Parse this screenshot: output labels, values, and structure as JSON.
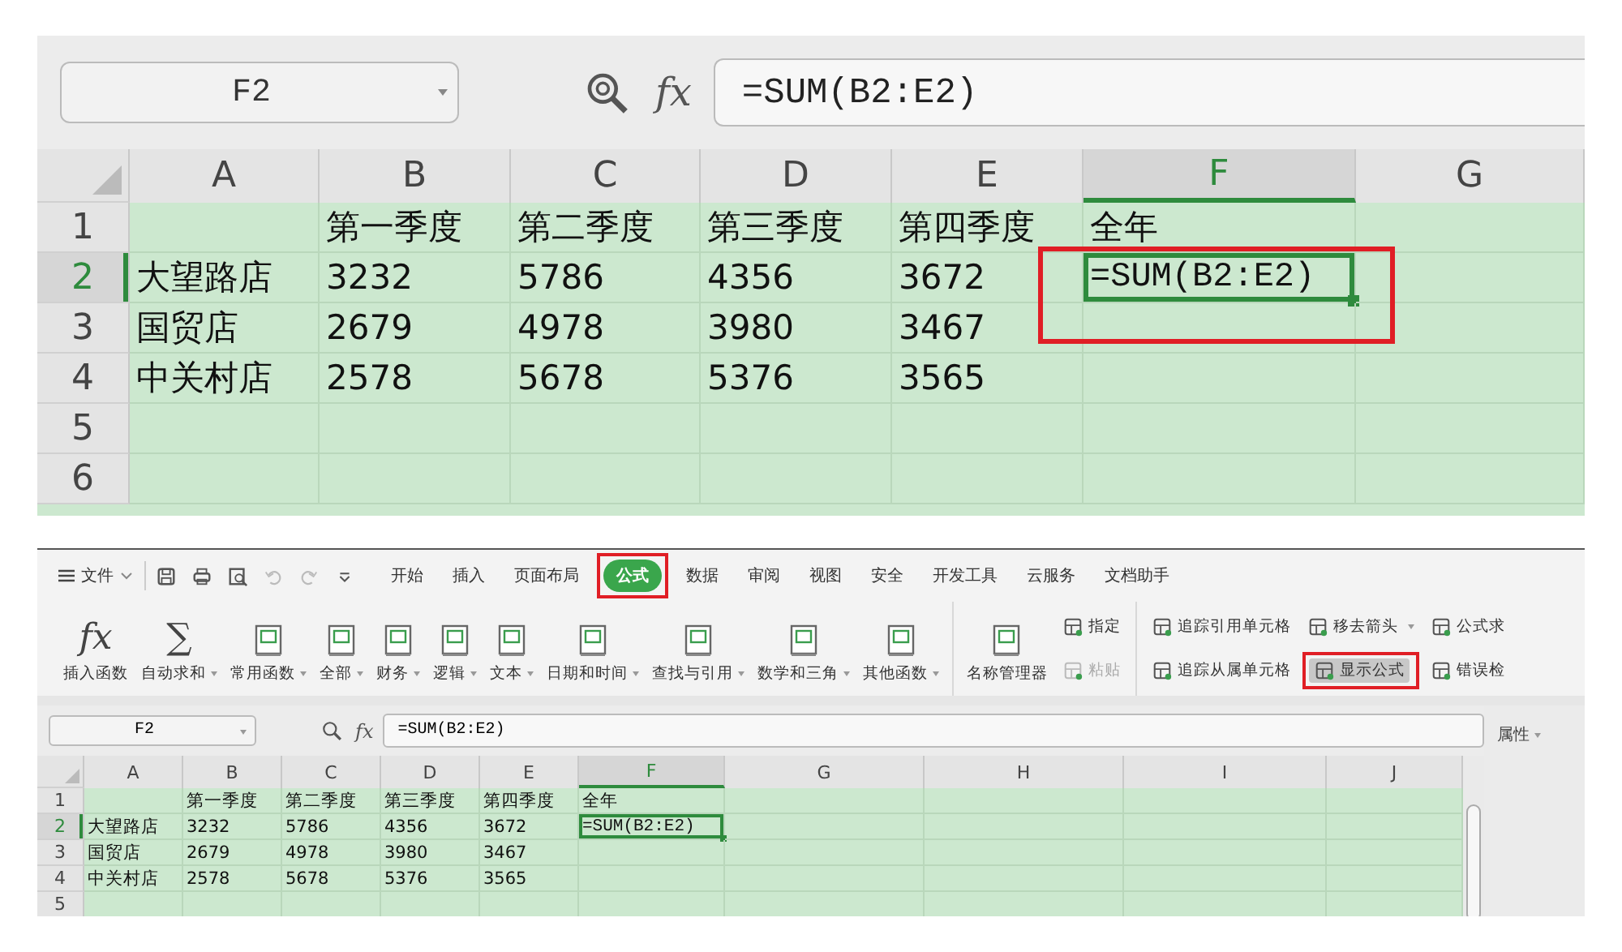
{
  "top_view": {
    "name_box": "F2",
    "fx": "fx",
    "formula": "=SUM(B2:E2)",
    "columns": [
      {
        "label": "A",
        "selected": false
      },
      {
        "label": "B",
        "selected": false
      },
      {
        "label": "C",
        "selected": false
      },
      {
        "label": "D",
        "selected": false
      },
      {
        "label": "E",
        "selected": false
      },
      {
        "label": "F",
        "selected": true
      },
      {
        "label": "G",
        "selected": false
      }
    ],
    "rows": [
      {
        "number": "1",
        "selected": false,
        "cells": [
          {
            "selected": false
          },
          {
            "text": "第一季度",
            "selected": false
          },
          {
            "text": "第二季度",
            "selected": false
          },
          {
            "text": "第三季度",
            "selected": false
          },
          {
            "text": "第四季度",
            "selected": false
          },
          {
            "text": "全年",
            "selected": false
          },
          {
            "selected": false
          }
        ]
      },
      {
        "number": "2",
        "selected": true,
        "cells": [
          {
            "text": "大望路店",
            "selected": false
          },
          {
            "text": "3232",
            "selected": false
          },
          {
            "text": "5786",
            "selected": false
          },
          {
            "text": "4356",
            "selected": false
          },
          {
            "text": "3672",
            "selected": false
          },
          {
            "text": "=SUM(B2:E2)",
            "selected": true,
            "callout": true
          },
          {
            "selected": false
          }
        ]
      },
      {
        "number": "3",
        "selected": false,
        "cells": [
          {
            "text": "国贸店",
            "selected": false
          },
          {
            "text": "2679",
            "selected": false
          },
          {
            "text": "4978",
            "selected": false
          },
          {
            "text": "3980",
            "selected": false
          },
          {
            "text": "3467",
            "selected": false
          },
          {
            "selected": false
          },
          {
            "selected": false
          }
        ]
      },
      {
        "number": "4",
        "selected": false,
        "cells": [
          {
            "text": "中关村店",
            "selected": false
          },
          {
            "text": "2578",
            "selected": false
          },
          {
            "text": "5678",
            "selected": false
          },
          {
            "text": "5376",
            "selected": false
          },
          {
            "text": "3565",
            "selected": false
          },
          {
            "selected": false
          },
          {
            "selected": false
          }
        ]
      },
      {
        "number": "5",
        "selected": false,
        "cells": [
          {
            "selected": false
          },
          {
            "selected": false
          },
          {
            "selected": false
          },
          {
            "selected": false
          },
          {
            "selected": false
          },
          {
            "selected": false
          },
          {
            "selected": false
          }
        ]
      },
      {
        "number": "6",
        "selected": false,
        "cells": [
          {
            "selected": false
          },
          {
            "selected": false
          },
          {
            "selected": false
          },
          {
            "selected": false
          },
          {
            "selected": false
          },
          {
            "selected": false
          },
          {
            "selected": false
          }
        ]
      }
    ]
  },
  "bottom_view": {
    "menu": {
      "label": "文件"
    },
    "quick_access": [
      {
        "disabled": false
      },
      {
        "disabled": false
      },
      {
        "disabled": false
      },
      {
        "disabled": true
      },
      {
        "disabled": true
      },
      {
        "disabled": false
      }
    ],
    "tabs": [
      {
        "label": "开始",
        "selected": false
      },
      {
        "label": "插入",
        "selected": false
      },
      {
        "label": "页面布局",
        "selected": false
      },
      {
        "label": "公式",
        "selected": true,
        "callout": true
      },
      {
        "label": "数据",
        "selected": false
      },
      {
        "label": "审阅",
        "selected": false
      },
      {
        "label": "视图",
        "selected": false
      },
      {
        "label": "安全",
        "selected": false
      },
      {
        "label": "开发工具",
        "selected": false
      },
      {
        "label": "云服务",
        "selected": false
      },
      {
        "label": "文档助手",
        "selected": false
      }
    ],
    "ribbon": [
      {
        "items": [
          {
            "kind": "glyph",
            "glyph": "fx",
            "label": "插入函数",
            "dropdown": false
          },
          {
            "kind": "glyph",
            "glyph": "∑",
            "label": "自动求和",
            "dropdown": true
          },
          {
            "kind": "large",
            "label": "常用函数",
            "dropdown": true
          },
          {
            "kind": "large",
            "label": "全部",
            "dropdown": true
          },
          {
            "kind": "large",
            "label": "财务",
            "dropdown": true
          },
          {
            "kind": "large",
            "label": "逻辑",
            "dropdown": true
          },
          {
            "kind": "large",
            "label": "文本",
            "dropdown": true
          },
          {
            "kind": "large",
            "label": "日期和时间",
            "dropdown": true
          },
          {
            "kind": "large",
            "label": "查找与引用",
            "dropdown": true
          },
          {
            "kind": "large",
            "label": "数学和三角",
            "dropdown": true
          },
          {
            "kind": "large",
            "label": "其他函数",
            "dropdown": true
          }
        ]
      },
      {
        "items": [
          {
            "kind": "large",
            "label": "名称管理器",
            "dropdown": false
          },
          {
            "kind": "small",
            "label": "指定",
            "dropdown": false,
            "disabled": false
          },
          {
            "kind": "small",
            "label": "粘贴",
            "dropdown": false,
            "disabled": true
          }
        ]
      },
      {
        "items": [
          {
            "kind": "small",
            "label": "追踪引用单元格",
            "dropdown": false,
            "disabled": false
          },
          {
            "kind": "small",
            "label": "追踪从属单元格",
            "dropdown": false,
            "disabled": false
          },
          {
            "kind": "small",
            "label": "移去箭头",
            "dropdown": true,
            "disabled": false
          },
          {
            "kind": "small",
            "label": "显示公式",
            "dropdown": false,
            "disabled": false,
            "pressed": true,
            "callout": true
          },
          {
            "kind": "small",
            "label": "公式求",
            "dropdown": false,
            "disabled": false
          },
          {
            "kind": "small",
            "label": "错误检",
            "dropdown": false,
            "disabled": false
          }
        ]
      }
    ],
    "name_box": "F2",
    "fx": "fx",
    "formula": "=SUM(B2:E2)",
    "properties": {
      "label": "属性"
    },
    "columns": [
      {
        "label": "A",
        "selected": false
      },
      {
        "label": "B",
        "selected": false
      },
      {
        "label": "C",
        "selected": false
      },
      {
        "label": "D",
        "selected": false
      },
      {
        "label": "E",
        "selected": false
      },
      {
        "label": "F",
        "selected": true
      },
      {
        "label": "G",
        "selected": false
      },
      {
        "label": "H",
        "selected": false
      },
      {
        "label": "I",
        "selected": false
      },
      {
        "label": "J",
        "selected": false
      }
    ],
    "rows": [
      {
        "number": "1",
        "selected": false,
        "cells": [
          {
            "selected": false
          },
          {
            "text": "第一季度",
            "selected": false
          },
          {
            "text": "第二季度",
            "selected": false
          },
          {
            "text": "第三季度",
            "selected": false
          },
          {
            "text": "第四季度",
            "selected": false
          },
          {
            "text": "全年",
            "selected": false
          },
          {
            "selected": false
          },
          {
            "selected": false
          },
          {
            "selected": false
          },
          {
            "selected": false
          }
        ]
      },
      {
        "number": "2",
        "selected": true,
        "cells": [
          {
            "text": "大望路店",
            "selected": false
          },
          {
            "text": "3232",
            "selected": false
          },
          {
            "text": "5786",
            "selected": false
          },
          {
            "text": "4356",
            "selected": false
          },
          {
            "text": "3672",
            "selected": false
          },
          {
            "text": "=SUM(B2:E2)",
            "selected": true
          },
          {
            "selected": false
          },
          {
            "selected": false
          },
          {
            "selected": false
          },
          {
            "selected": false
          }
        ]
      },
      {
        "number": "3",
        "selected": false,
        "cells": [
          {
            "text": "国贸店",
            "selected": false
          },
          {
            "text": "2679",
            "selected": false
          },
          {
            "text": "4978",
            "selected": false
          },
          {
            "text": "3980",
            "selected": false
          },
          {
            "text": "3467",
            "selected": false
          },
          {
            "selected": false
          },
          {
            "selected": false
          },
          {
            "selected": false
          },
          {
            "selected": false
          },
          {
            "selected": false
          }
        ]
      },
      {
        "number": "4",
        "selected": false,
        "cells": [
          {
            "text": "中关村店",
            "selected": false
          },
          {
            "text": "2578",
            "selected": false
          },
          {
            "text": "5678",
            "selected": false
          },
          {
            "text": "5376",
            "selected": false
          },
          {
            "text": "3565",
            "selected": false
          },
          {
            "selected": false
          },
          {
            "selected": false
          },
          {
            "selected": false
          },
          {
            "selected": false
          },
          {
            "selected": false
          }
        ]
      },
      {
        "number": "5",
        "selected": false,
        "cells": [
          {
            "selected": false
          },
          {
            "selected": false
          },
          {
            "selected": false
          },
          {
            "selected": false
          },
          {
            "selected": false
          },
          {
            "selected": false
          },
          {
            "selected": false
          },
          {
            "selected": false
          },
          {
            "selected": false
          },
          {
            "selected": false
          }
        ]
      }
    ]
  }
}
